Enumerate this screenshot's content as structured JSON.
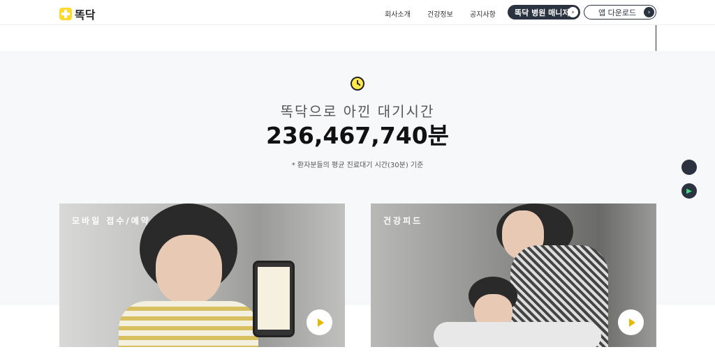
{
  "header": {
    "logo": "똑닥",
    "nav": [
      "회사소개",
      "건강정보",
      "공지사항"
    ],
    "manager_button": "똑닥 병원 매니저",
    "download_button": "앱 다운로드"
  },
  "stats": {
    "subtitle": "똑닥으로 아낀 대기시간",
    "value": "236,467,740분",
    "note": "* 환자분들의 평균 진료대기 시간(30분) 기준"
  },
  "side": {
    "apple": "apple-icon",
    "play": "google-play-icon"
  },
  "cards": [
    {
      "title": "모바일 접수/예약"
    },
    {
      "title": "건강피드"
    }
  ]
}
